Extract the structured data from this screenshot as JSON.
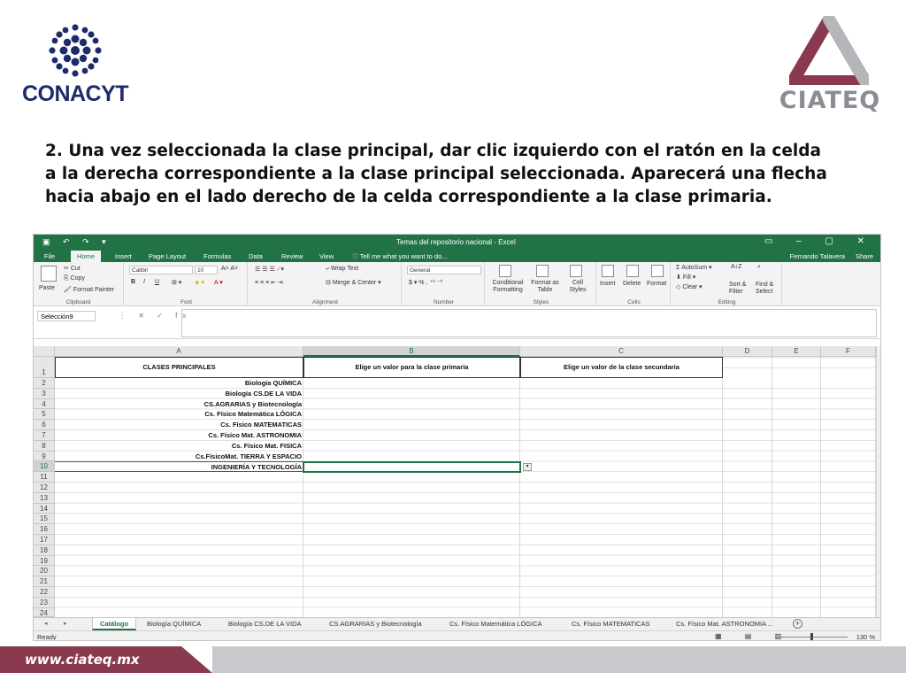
{
  "slide": {
    "logo_left": "CONACYT",
    "logo_right": "CIATEQ",
    "instruction_lines": [
      "2. Una vez seleccionada la clase principal, dar clic izquierdo con el ratón en la celda",
      "a la derecha correspondiente a la clase principal seleccionada. Aparecerá una flecha",
      "hacia abajo en el lado derecho de la celda correspondiente a la clase primaria."
    ],
    "footer_url": "www.ciateq.mx",
    "colors": {
      "accent": "#8a3a4f",
      "excel_green": "#217346",
      "conacyt_blue": "#1d2b6b"
    }
  },
  "excel": {
    "title": "Temas del repositorio nacional - Excel",
    "user": "Fernando Talavera",
    "share": "Share",
    "tell_me": "Tell me what you want to do...",
    "tabs": [
      "File",
      "Home",
      "Insert",
      "Page Layout",
      "Formulas",
      "Data",
      "Review",
      "View"
    ],
    "active_tab": "Home",
    "ribbon": {
      "clipboard": {
        "paste": "Paste",
        "cut": "Cut",
        "copy": "Copy",
        "format_painter": "Format Painter",
        "label": "Clipboard"
      },
      "font": {
        "name": "Calibri",
        "size": "10",
        "label": "Font"
      },
      "alignment": {
        "wrap": "Wrap Text",
        "merge": "Merge & Center",
        "label": "Alignment"
      },
      "number": {
        "format": "General",
        "label": "Number"
      },
      "styles": {
        "conditional": "Conditional Formatting",
        "format_table": "Format as Table",
        "cell_styles": "Cell Styles",
        "label": "Styles"
      },
      "cells": {
        "insert": "Insert",
        "delete": "Delete",
        "format": "Format",
        "label": "Cells"
      },
      "editing": {
        "autosum": "AutoSum",
        "fill": "Fill",
        "clear": "Clear",
        "sort": "Sort & Filter",
        "find": "Find & Select",
        "label": "Editing"
      }
    },
    "name_box": "Selección9",
    "columns": [
      "A",
      "B",
      "C",
      "D",
      "E",
      "F"
    ],
    "selected_column": "B",
    "rows": [
      "1",
      "2",
      "3",
      "4",
      "5",
      "6",
      "7",
      "8",
      "9",
      "10",
      "11",
      "12",
      "13",
      "14",
      "15",
      "16",
      "17",
      "18",
      "19",
      "20",
      "21",
      "22",
      "23",
      "24"
    ],
    "selected_row": "10",
    "header_cells": {
      "A1": "CLASES PRINCIPALES",
      "B1": "Elige un valor para la clase primaria",
      "C1": "Elige un valor de la clase secundaria"
    },
    "column_a_values": [
      "Biología QUÍMICA",
      "Biología CS.DE LA VIDA",
      "CS.AGRARIAS y Biotecnología",
      "Cs. Físico Matemática LÓGICA",
      "Cs. Físico MATEMATICAS",
      "Cs. Físico Mat. ASTRONOMIA",
      "Cs. Físico Mat. FISICA",
      "Cs.FísicoMat. TIERRA Y ESPACIO",
      "INGENIERÍA Y TECNOLOGÍA"
    ],
    "sheet_tabs": [
      "Catálogo",
      "Biología QUÍMICA",
      "Biología CS.DE LA VIDA",
      "CS.AGRARIAS y Biotecnología",
      "Cs. Físico Matemática LÓGICA",
      "Cs. Físico MATEMATICAS",
      "Cs. Físico Mat. ASTRONOMIA ..."
    ],
    "active_sheet": "Catálogo",
    "status": "Ready",
    "zoom": "130 %"
  }
}
